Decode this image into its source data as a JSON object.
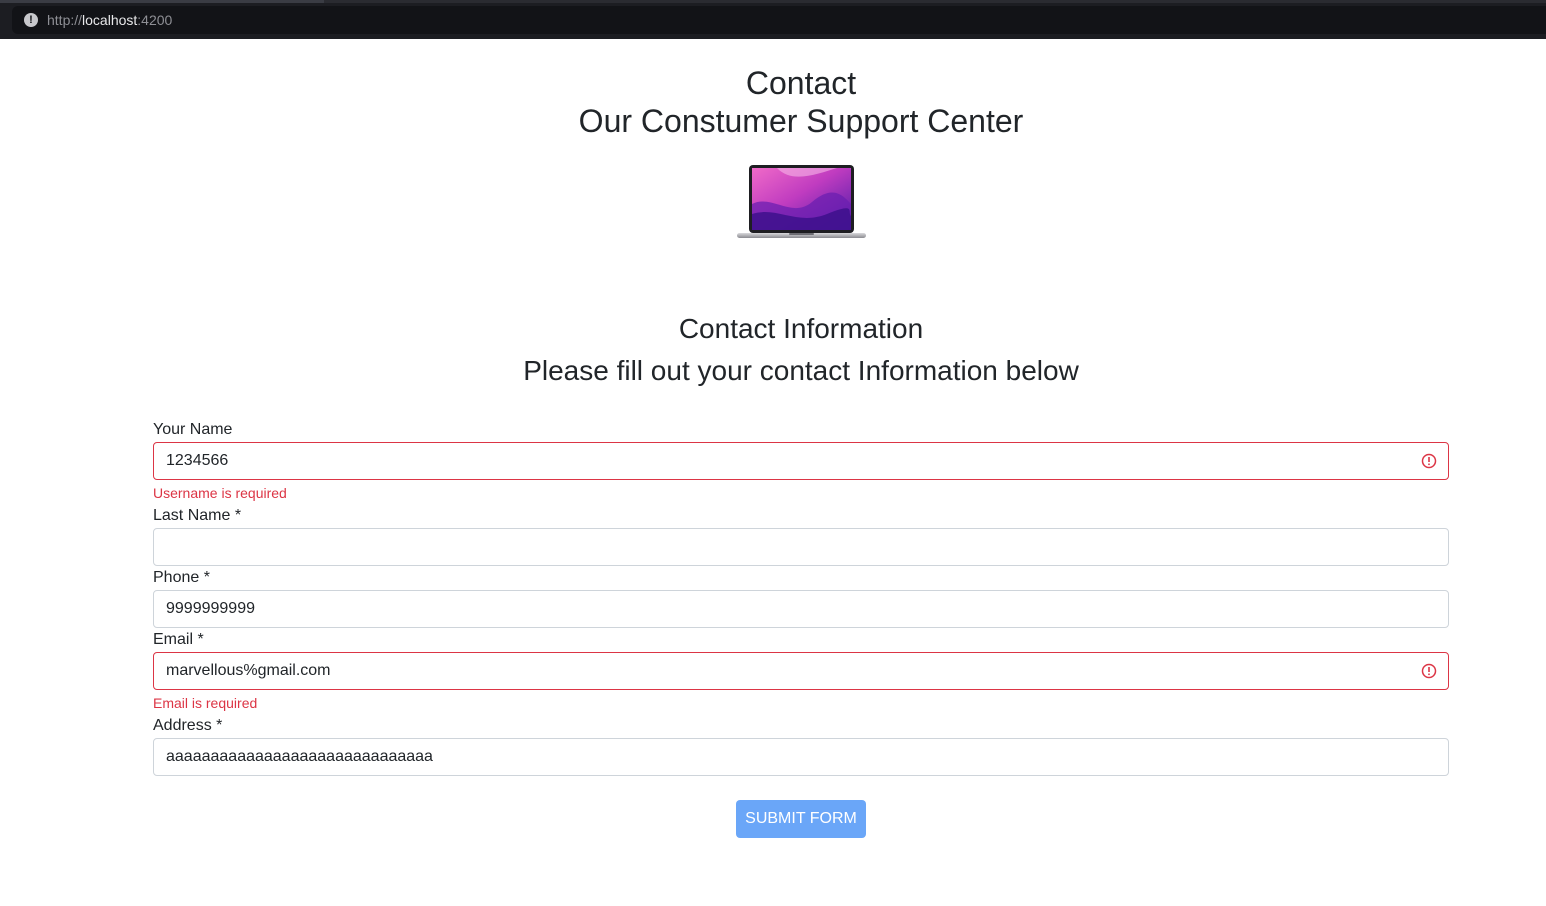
{
  "browser": {
    "url_scheme": "http://",
    "url_host": "localhost",
    "url_port": ":4200"
  },
  "header": {
    "title": "Contact",
    "subtitle": "Our Constumer Support Center",
    "image_icon": "laptop-image"
  },
  "section": {
    "title": "Contact Information",
    "subtitle": "Please fill out your contact Information below"
  },
  "form": {
    "name": {
      "label": "Your Name",
      "value": "1234566",
      "error": "Username is required",
      "invalid": true
    },
    "last_name": {
      "label": "Last Name *",
      "value": "",
      "invalid": false
    },
    "phone": {
      "label": "Phone *",
      "value": "9999999999",
      "invalid": false
    },
    "email": {
      "label": "Email *",
      "value": "marvellous%gmail.com",
      "error": "Email is required",
      "invalid": true
    },
    "address": {
      "label": "Address *",
      "value": "aaaaaaaaaaaaaaaaaaaaaaaaaaaaaa",
      "invalid": false
    },
    "submit_label": "SUBMIT FORM"
  },
  "colors": {
    "error": "#dc3545",
    "button": "#6aa6f8",
    "border": "#ced4da",
    "text": "#212529"
  }
}
